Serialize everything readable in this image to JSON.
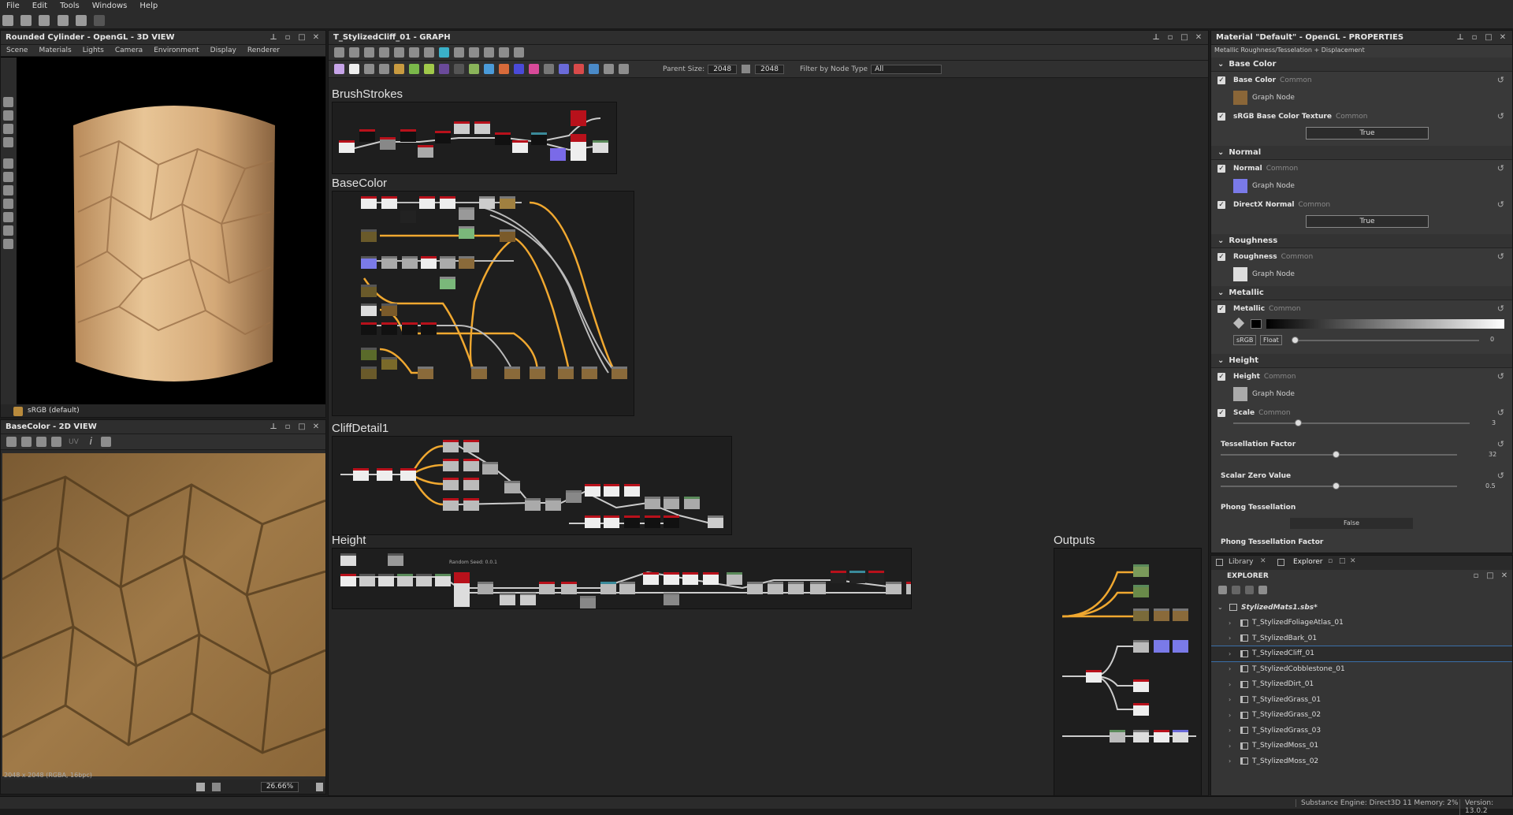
{
  "menu": [
    "File",
    "Edit",
    "Tools",
    "Windows",
    "Help"
  ],
  "view3d": {
    "title": "Rounded Cylinder - OpenGL - 3D VIEW",
    "menu": [
      "Scene",
      "Materials",
      "Lights",
      "Camera",
      "Environment",
      "Display",
      "Renderer"
    ],
    "colorspace": "sRGB (default)"
  },
  "view2d": {
    "title": "BaseColor - 2D VIEW",
    "uv_label": "UV",
    "zoom": "26.66%",
    "info": "2048 x 2048 (RGBA, 16bpc)"
  },
  "graph": {
    "title": "T_StylizedCliff_01 - GRAPH",
    "parent_size_label": "Parent Size:",
    "parent_size": "2048",
    "size2": "2048",
    "filter_label": "Filter by Node Type",
    "filter_value": "All",
    "frames": [
      "BrushStrokes",
      "BaseColor",
      "CliffDetail1",
      "Height",
      "Outputs"
    ],
    "height_note": "Random Seed: 0.0.1"
  },
  "properties": {
    "title": "Material \"Default\" - OpenGL - PROPERTIES",
    "subtitle": "Metallic Roughness/Tesselation + Displacement",
    "common": "Common",
    "graph_node": "Graph Node",
    "sections": {
      "base_color": "Base Color",
      "normal": "Normal",
      "roughness": "Roughness",
      "metallic": "Metallic",
      "height": "Height"
    },
    "rows": {
      "base_color": "Base Color",
      "srgb_base": "sRGB Base Color Texture",
      "srgb_base_value": "True",
      "normal": "Normal",
      "directx": "DirectX Normal",
      "directx_value": "True",
      "roughness": "Roughness",
      "metallic": "Metallic",
      "metallic_value": "0",
      "srgb_btn": "sRGB",
      "float_btn": "Float",
      "height": "Height",
      "scale": "Scale",
      "scale_value": "3",
      "tess_factor": "Tessellation Factor",
      "tess_value": "32",
      "scalar_zero": "Scalar Zero Value",
      "scalar_zero_value": "0.5",
      "phong": "Phong Tessellation",
      "phong_value": "False",
      "phong_factor": "Phong Tessellation Factor"
    }
  },
  "explorer": {
    "tab_library": "Library",
    "tab_explorer": "Explorer",
    "title": "EXPLORER",
    "package": "StylizedMats1.sbs*",
    "items": [
      "T_StylizedFoliageAtlas_01",
      "T_StylizedBark_01",
      "T_StylizedCliff_01",
      "T_StylizedCobblestone_01",
      "T_StylizedDirt_01",
      "T_StylizedGrass_01",
      "T_StylizedGrass_02",
      "T_StylizedGrass_03",
      "T_StylizedMoss_01",
      "T_StylizedMoss_02"
    ],
    "selected_index": 2
  },
  "status": {
    "engine": "Substance Engine: Direct3D 11  Memory: 2%",
    "version": "Version: 13.0.2"
  },
  "colors": {
    "accent_orange": "#f0a830",
    "node_red": "#b8111b",
    "selection_blue": "#3a6ea8"
  }
}
